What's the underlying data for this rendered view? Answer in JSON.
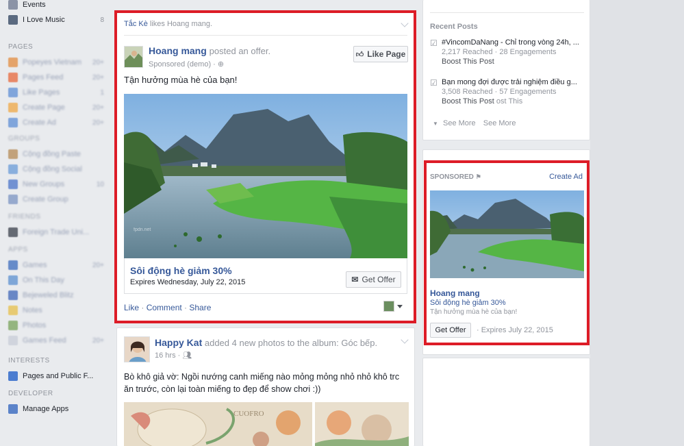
{
  "sidebar": {
    "top_items": [
      {
        "label": "Events",
        "count": "",
        "icon": "calendar-icon",
        "color": "#8b93a6"
      },
      {
        "label": "I Love Music",
        "count": "8",
        "icon": "music-group-icon",
        "color": "#5b6a80"
      }
    ],
    "pages_heading": "PAGES",
    "pages_items": [
      {
        "label": "Popeyes Vietnam",
        "count": "20+",
        "color": "#e38b3e"
      },
      {
        "label": "Pages Feed",
        "count": "20+",
        "color": "#e8683a"
      },
      {
        "label": "Like Pages",
        "count": "1",
        "color": "#5d8ed5"
      },
      {
        "label": "Create Page",
        "count": "20+",
        "color": "#f0a844"
      },
      {
        "label": "Create Ad",
        "count": "20+",
        "color": "#5d8ed5"
      }
    ],
    "groups_heading": "GROUPS",
    "groups_count": "10",
    "groups_items": [
      {
        "label": "Cộng đồng Paste",
        "count": "",
        "color": "#b58a55"
      },
      {
        "label": "Cộng đồng Social",
        "count": "",
        "color": "#6a9bd8"
      },
      {
        "label": "New Groups",
        "count": "10",
        "color": "#4a74c9"
      },
      {
        "label": "Create Group",
        "count": "",
        "color": "#7b93c2"
      }
    ],
    "friends_heading": "FRIENDS",
    "friends_items": [
      {
        "label": "Foreign Trade Uni...",
        "count": "",
        "color": "#3a3f4a"
      }
    ],
    "apps_heading": "APPS",
    "apps_items": [
      {
        "label": "Games",
        "count": "20+",
        "color": "#3b6bbd"
      },
      {
        "label": "On This Day",
        "count": "",
        "color": "#5b8fd0"
      },
      {
        "label": "Bejeweled Blitz",
        "count": "",
        "color": "#3f66b8"
      },
      {
        "label": "Notes",
        "count": "",
        "color": "#e7c04a"
      },
      {
        "label": "Photos",
        "count": "",
        "color": "#78a35a"
      },
      {
        "label": "Games Feed",
        "count": "20+",
        "color": "#c8cdd8"
      }
    ],
    "interests_heading": "INTERESTS",
    "interests_items": [
      {
        "label": "Pages and Public F...",
        "count": "",
        "color": "#4c7dd0"
      }
    ],
    "developer_heading": "DEVELOPER",
    "developer_items": [
      {
        "label": "Manage Apps",
        "count": "",
        "color": "#5b83c9"
      }
    ]
  },
  "post1": {
    "story_actor": "Tắc Kè",
    "story_text": "likes Hoang mang.",
    "page_name": "Hoang mang",
    "action": "posted an offer.",
    "sponsored": "Sponsored (demo) · ",
    "like_page": "Like Page",
    "message": "Tận hưởng mùa hè của bạn!",
    "offer_title": "Sôi động hè giảm 30%",
    "expires": "Expires Wednesday, July 22, 2015",
    "get_offer": "Get Offer",
    "actions": [
      "Like",
      "Comment",
      "Share"
    ]
  },
  "post2": {
    "name": "Happy Kat",
    "action": "added 4 new photos to the album:",
    "album": "Góc bếp.",
    "time": "16 hrs · ",
    "text": "Bò khô giả vờ: Ngồi nướng canh miếng nào mỏng mỏng nhỏ nhỏ khô trc ăn trước, còn lại toàn miếng to đẹp để show chơi :))",
    "photo_text": "CUOFRO"
  },
  "recent": {
    "title": "Recent Posts",
    "posts": [
      {
        "title": "#VincomDaNang - Chỉ trong vòng 24h, ...",
        "stats": "2,217 Reached · 28 Engagements",
        "boost": "Boost This Post",
        "ghost": ""
      },
      {
        "title": "Bạn mong đợi được trải nghiệm điều g...",
        "stats": "3,508 Reached · 57 Engagements",
        "boost": "Boost This Post",
        "ghost": "ost This"
      }
    ],
    "see_more": "See More",
    "see_more2": "See More"
  },
  "ad": {
    "sponsored": "SPONSORED",
    "create_ad": "Create Ad",
    "page_name": "Hoang mang",
    "offer": "Sôi động hè giảm 30%",
    "message": "Tận hưởng mùa hè của bạn!",
    "get_offer": "Get Offer",
    "expires": "· Expires July 22, 2015"
  },
  "colors": {
    "highlight": "#dd1c27",
    "link": "#365899",
    "background": "#e9ebee"
  }
}
